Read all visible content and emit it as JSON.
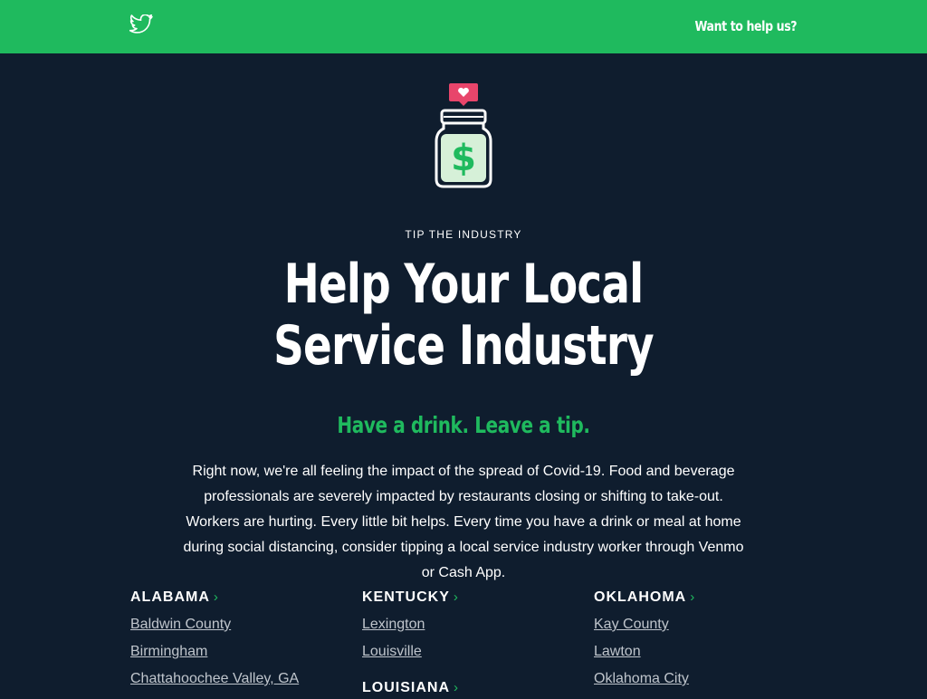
{
  "header": {
    "twitter_icon": "twitter-icon",
    "help_link": "Want to help us?",
    "background": "#1fba5e"
  },
  "hero": {
    "logo_icon": "tip-jar-heart-icon",
    "eyebrow": "TIP THE INDUSTRY",
    "headline_line1": "Help Your Local",
    "headline_line2": "Service Industry",
    "tagline": "Have a drink. Leave a tip.",
    "intro": "Right now, we're all feeling the impact of the spread of Covid-19. Food and beverage professionals are severely impacted by restaurants closing or shifting to take-out. Workers are hurting. Every little bit helps. Every time you have a drink or meal at home during social distancing, consider tipping a local service industry worker through Venmo or Cash App."
  },
  "states": [
    {
      "name": "ALABAMA",
      "chevron": "›",
      "cities": [
        "Baldwin County",
        "Birmingham",
        "Chattahoochee Valley, GA"
      ]
    },
    {
      "name": "KENTUCKY",
      "chevron": "›",
      "cities": [
        "Lexington",
        "Louisville"
      ]
    },
    {
      "name": "OKLAHOMA",
      "chevron": "›",
      "cities": [
        "Kay County",
        "Lawton",
        "Oklahoma City"
      ]
    }
  ],
  "states_below": [
    {
      "name": "LOUISIANA",
      "chevron": "›"
    }
  ],
  "colors": {
    "accent": "#1fba5e",
    "background": "#0f1d2e",
    "heart": "#e8456b"
  }
}
